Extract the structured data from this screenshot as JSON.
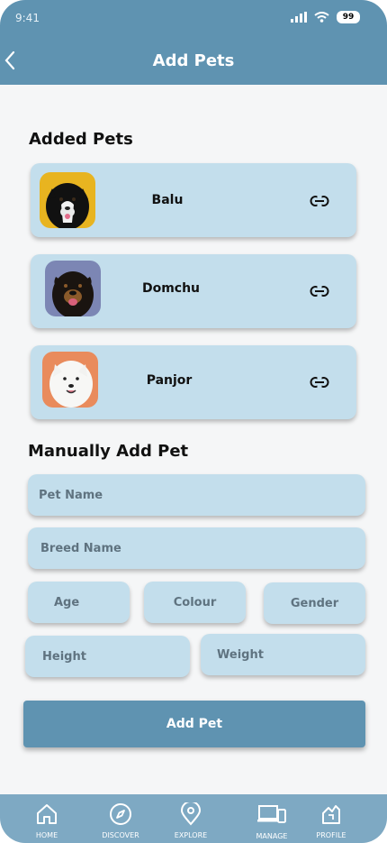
{
  "status": {
    "time": "9:41",
    "battery": "99"
  },
  "header": {
    "title": "Add Pets"
  },
  "added_pets": {
    "title": "Added Pets",
    "items": [
      {
        "name": "Balu"
      },
      {
        "name": "Domchu"
      },
      {
        "name": "Panjor"
      }
    ]
  },
  "manual": {
    "title": "Manually Add Pet",
    "pet_name": "Pet Name",
    "breed_name": "Breed Name",
    "age": "Age",
    "colour": "Colour",
    "gender": "Gender",
    "height": "Height",
    "weight": "Weight",
    "submit": "Add Pet"
  },
  "nav": {
    "items": [
      {
        "label": "HOME",
        "icon": "home-icon"
      },
      {
        "label": "DISCOVER",
        "icon": "compass-icon"
      },
      {
        "label": "EXPLORE",
        "icon": "location-pin-icon"
      },
      {
        "label": "MANAGE",
        "icon": "devices-icon"
      },
      {
        "label": "PROFILE",
        "icon": "profile-icon"
      }
    ]
  },
  "colors": {
    "accent": "#5f93b1",
    "card": "#c3deec",
    "nav": "#7ea9c3"
  }
}
